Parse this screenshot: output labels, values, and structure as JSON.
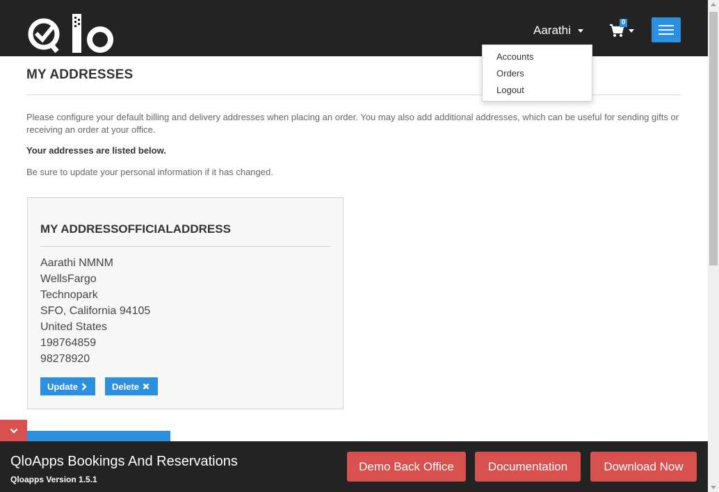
{
  "header": {
    "logo_alt": "Qlo",
    "user_name": "Aarathi",
    "cart_count": "0"
  },
  "dropdown": {
    "items": [
      "Accounts",
      "Orders",
      "Logout"
    ]
  },
  "main": {
    "title": "MY ADDRESSES",
    "intro": "Please configure your default billing and delivery addresses when placing an order. You may also add additional addresses, which can be useful for sending gifts or receiving an order at your office.",
    "listed": "Your addresses are listed below.",
    "note": "Be sure to update your personal information if it has changed.",
    "address": {
      "title": "MY ADDRESSOFFICIALADDRESS",
      "lines": [
        "Aarathi NMNM",
        "WellsFargo",
        "Technopark",
        "SFO, California 94105",
        "United States",
        "198764859",
        "98278920"
      ],
      "update_label": "Update",
      "delete_label": "Delete"
    }
  },
  "footer": {
    "title": "QloApps Bookings And Reservations",
    "version": "Qloapps Version 1.5.1",
    "buttons": [
      "Demo Back Office",
      "Documentation",
      "Download Now"
    ]
  },
  "colors": {
    "header_bg": "#232323",
    "accent_blue": "#2d8fe0",
    "accent_red": "#d9514e"
  }
}
